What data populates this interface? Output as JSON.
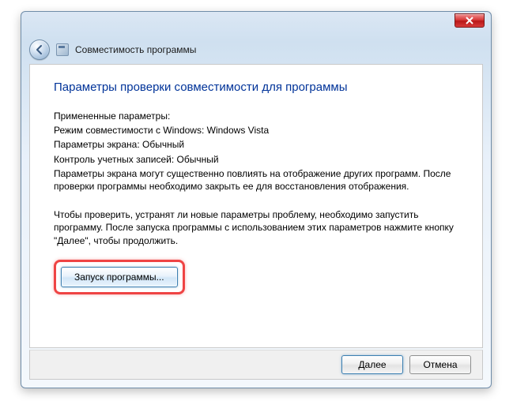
{
  "header": {
    "title": "Совместимость программы"
  },
  "content": {
    "heading": "Параметры проверки совместимости для программы",
    "applied_label": "Примененные параметры:",
    "compat_mode": "Режим совместимости с Windows: Windows Vista",
    "screen_params": "Параметры экрана:  Обычный",
    "uac": "Контроль учетных записей:  Обычный",
    "note": "Параметры экрана могут существенно повлиять на отображение других программ. После проверки программы необходимо закрыть ее для восстановления отображения.",
    "instruction": "Чтобы проверить, устранят ли новые параметры проблему, необходимо запустить программу. После запуска программы с использованием этих параметров нажмите кнопку \"Далее\", чтобы продолжить.",
    "start_button": "Запуск программы..."
  },
  "footer": {
    "next": "Далее",
    "cancel": "Отмена"
  }
}
